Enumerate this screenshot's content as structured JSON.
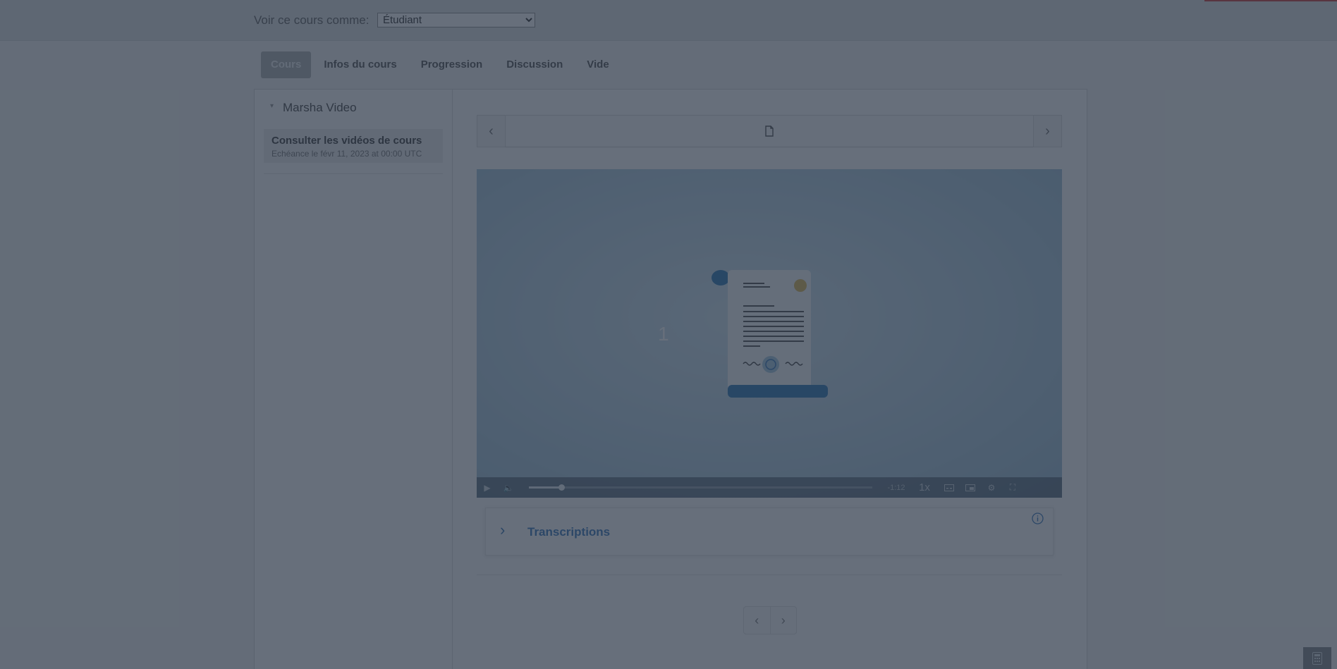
{
  "preview": {
    "label": "Voir ce cours comme:",
    "role_selected": "Étudiant"
  },
  "tabs": [
    {
      "label": "Cours",
      "active": true
    },
    {
      "label": "Infos du cours"
    },
    {
      "label": "Progression"
    },
    {
      "label": "Discussion"
    },
    {
      "label": "Vide"
    }
  ],
  "sidebar": {
    "chapter_title": "Marsha Video",
    "section": {
      "title": "Consulter les vidéos de cours",
      "due": "Echéance le févr 11, 2023 at 00:00 UTC"
    }
  },
  "sequence": {
    "unit_icon": "document-icon"
  },
  "video": {
    "slide_number": "1",
    "time_remaining": "-1:12",
    "playback_rate": "1x",
    "progress_fraction": 0.095
  },
  "transcriptions": {
    "label": "Transcriptions"
  },
  "colors": {
    "accent_blue": "#2c6fb6",
    "overlay": "#2c3848"
  }
}
